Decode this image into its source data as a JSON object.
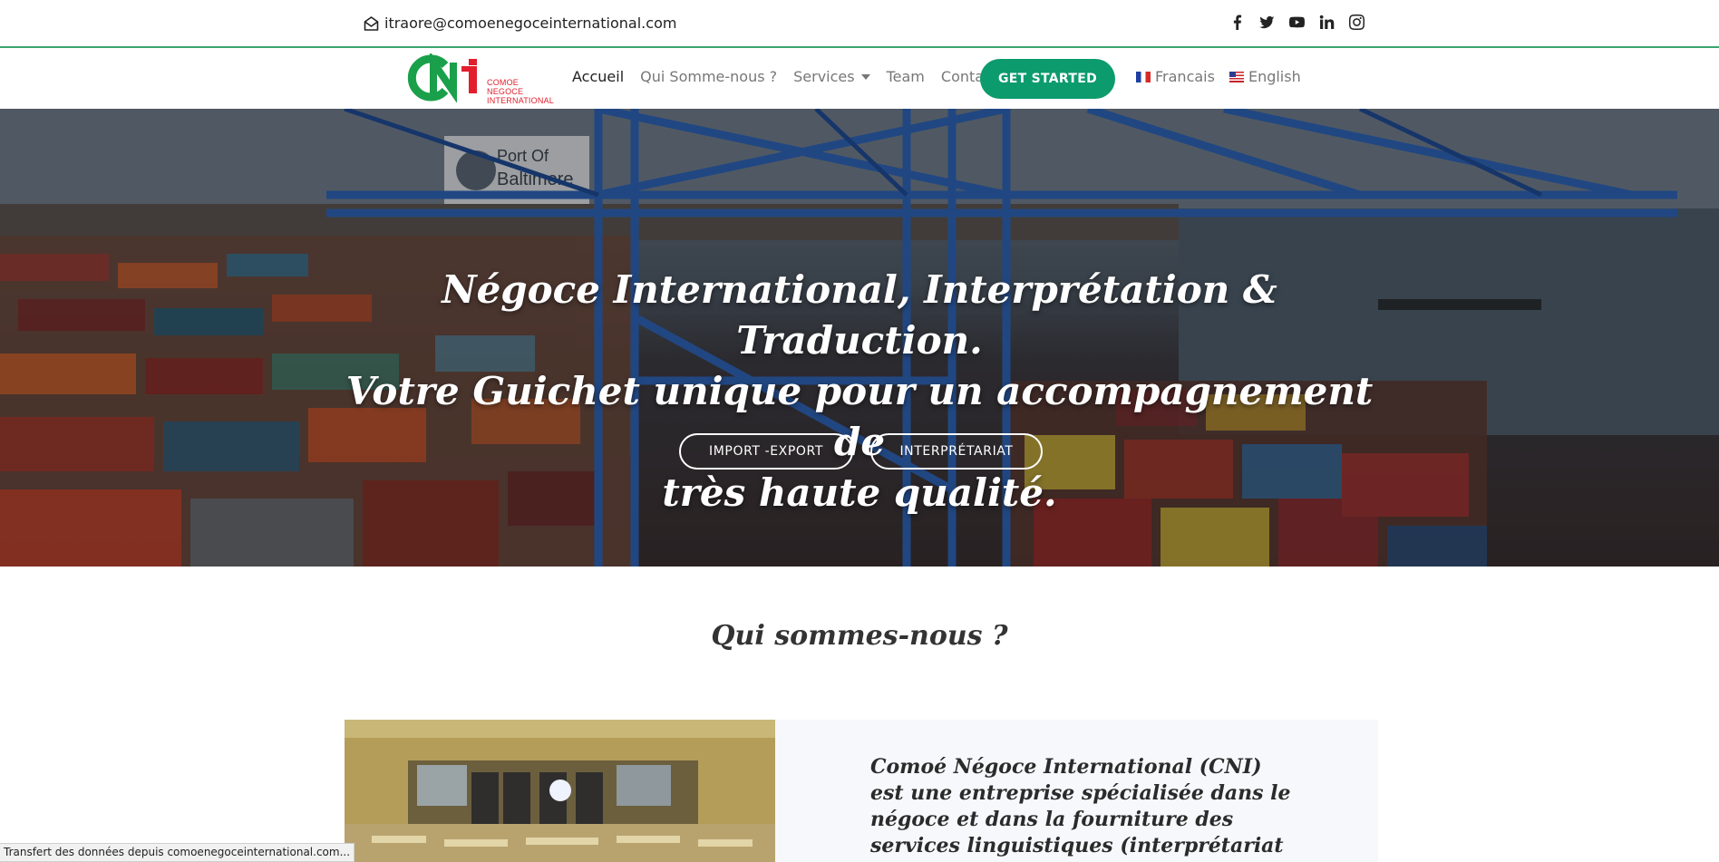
{
  "topbar": {
    "email": "itraore@comoenegoceinternational.com",
    "socials": [
      "facebook-icon",
      "twitter-icon",
      "youtube-icon",
      "linkedin-icon",
      "instagram-icon"
    ]
  },
  "header": {
    "logo": {
      "mark": "CNI",
      "line1": "COMOE",
      "line2": "NEGOCE",
      "line3": "INTERNATIONAL"
    },
    "nav": [
      {
        "label": "Accueil",
        "active": true
      },
      {
        "label": "Qui Somme-nous ?"
      },
      {
        "label": "Services",
        "dropdown": true
      },
      {
        "label": "Team"
      },
      {
        "label": "Contact"
      }
    ],
    "cta": "GET STARTED",
    "languages": [
      {
        "label": "Francais",
        "flag": "fr"
      },
      {
        "label": "English",
        "flag": "us"
      }
    ]
  },
  "hero": {
    "line1": "Négoce International, Interprétation & Traduction.",
    "line2": "Votre Guichet unique pour un accompagnement de",
    "line3": "très haute qualité.",
    "buttons": [
      "IMPORT -EXPORT",
      "INTERPRÉTARIAT"
    ],
    "sign_line1": "Port Of",
    "sign_line2": "Baltimore"
  },
  "about": {
    "title": "Qui sommes-nous ?",
    "text": "Comoé Négoce International (CNI) est une entreprise spécialisée dans le négoce et dans la fourniture des services linguistiques (interprétariat et"
  },
  "status": "Transfert des données depuis comoenegoceinternational.com...",
  "colors": {
    "accent": "#0c9b6c",
    "divider": "#3aa56f",
    "logo_green": "#1aa04a",
    "logo_red": "#e21e2c"
  }
}
